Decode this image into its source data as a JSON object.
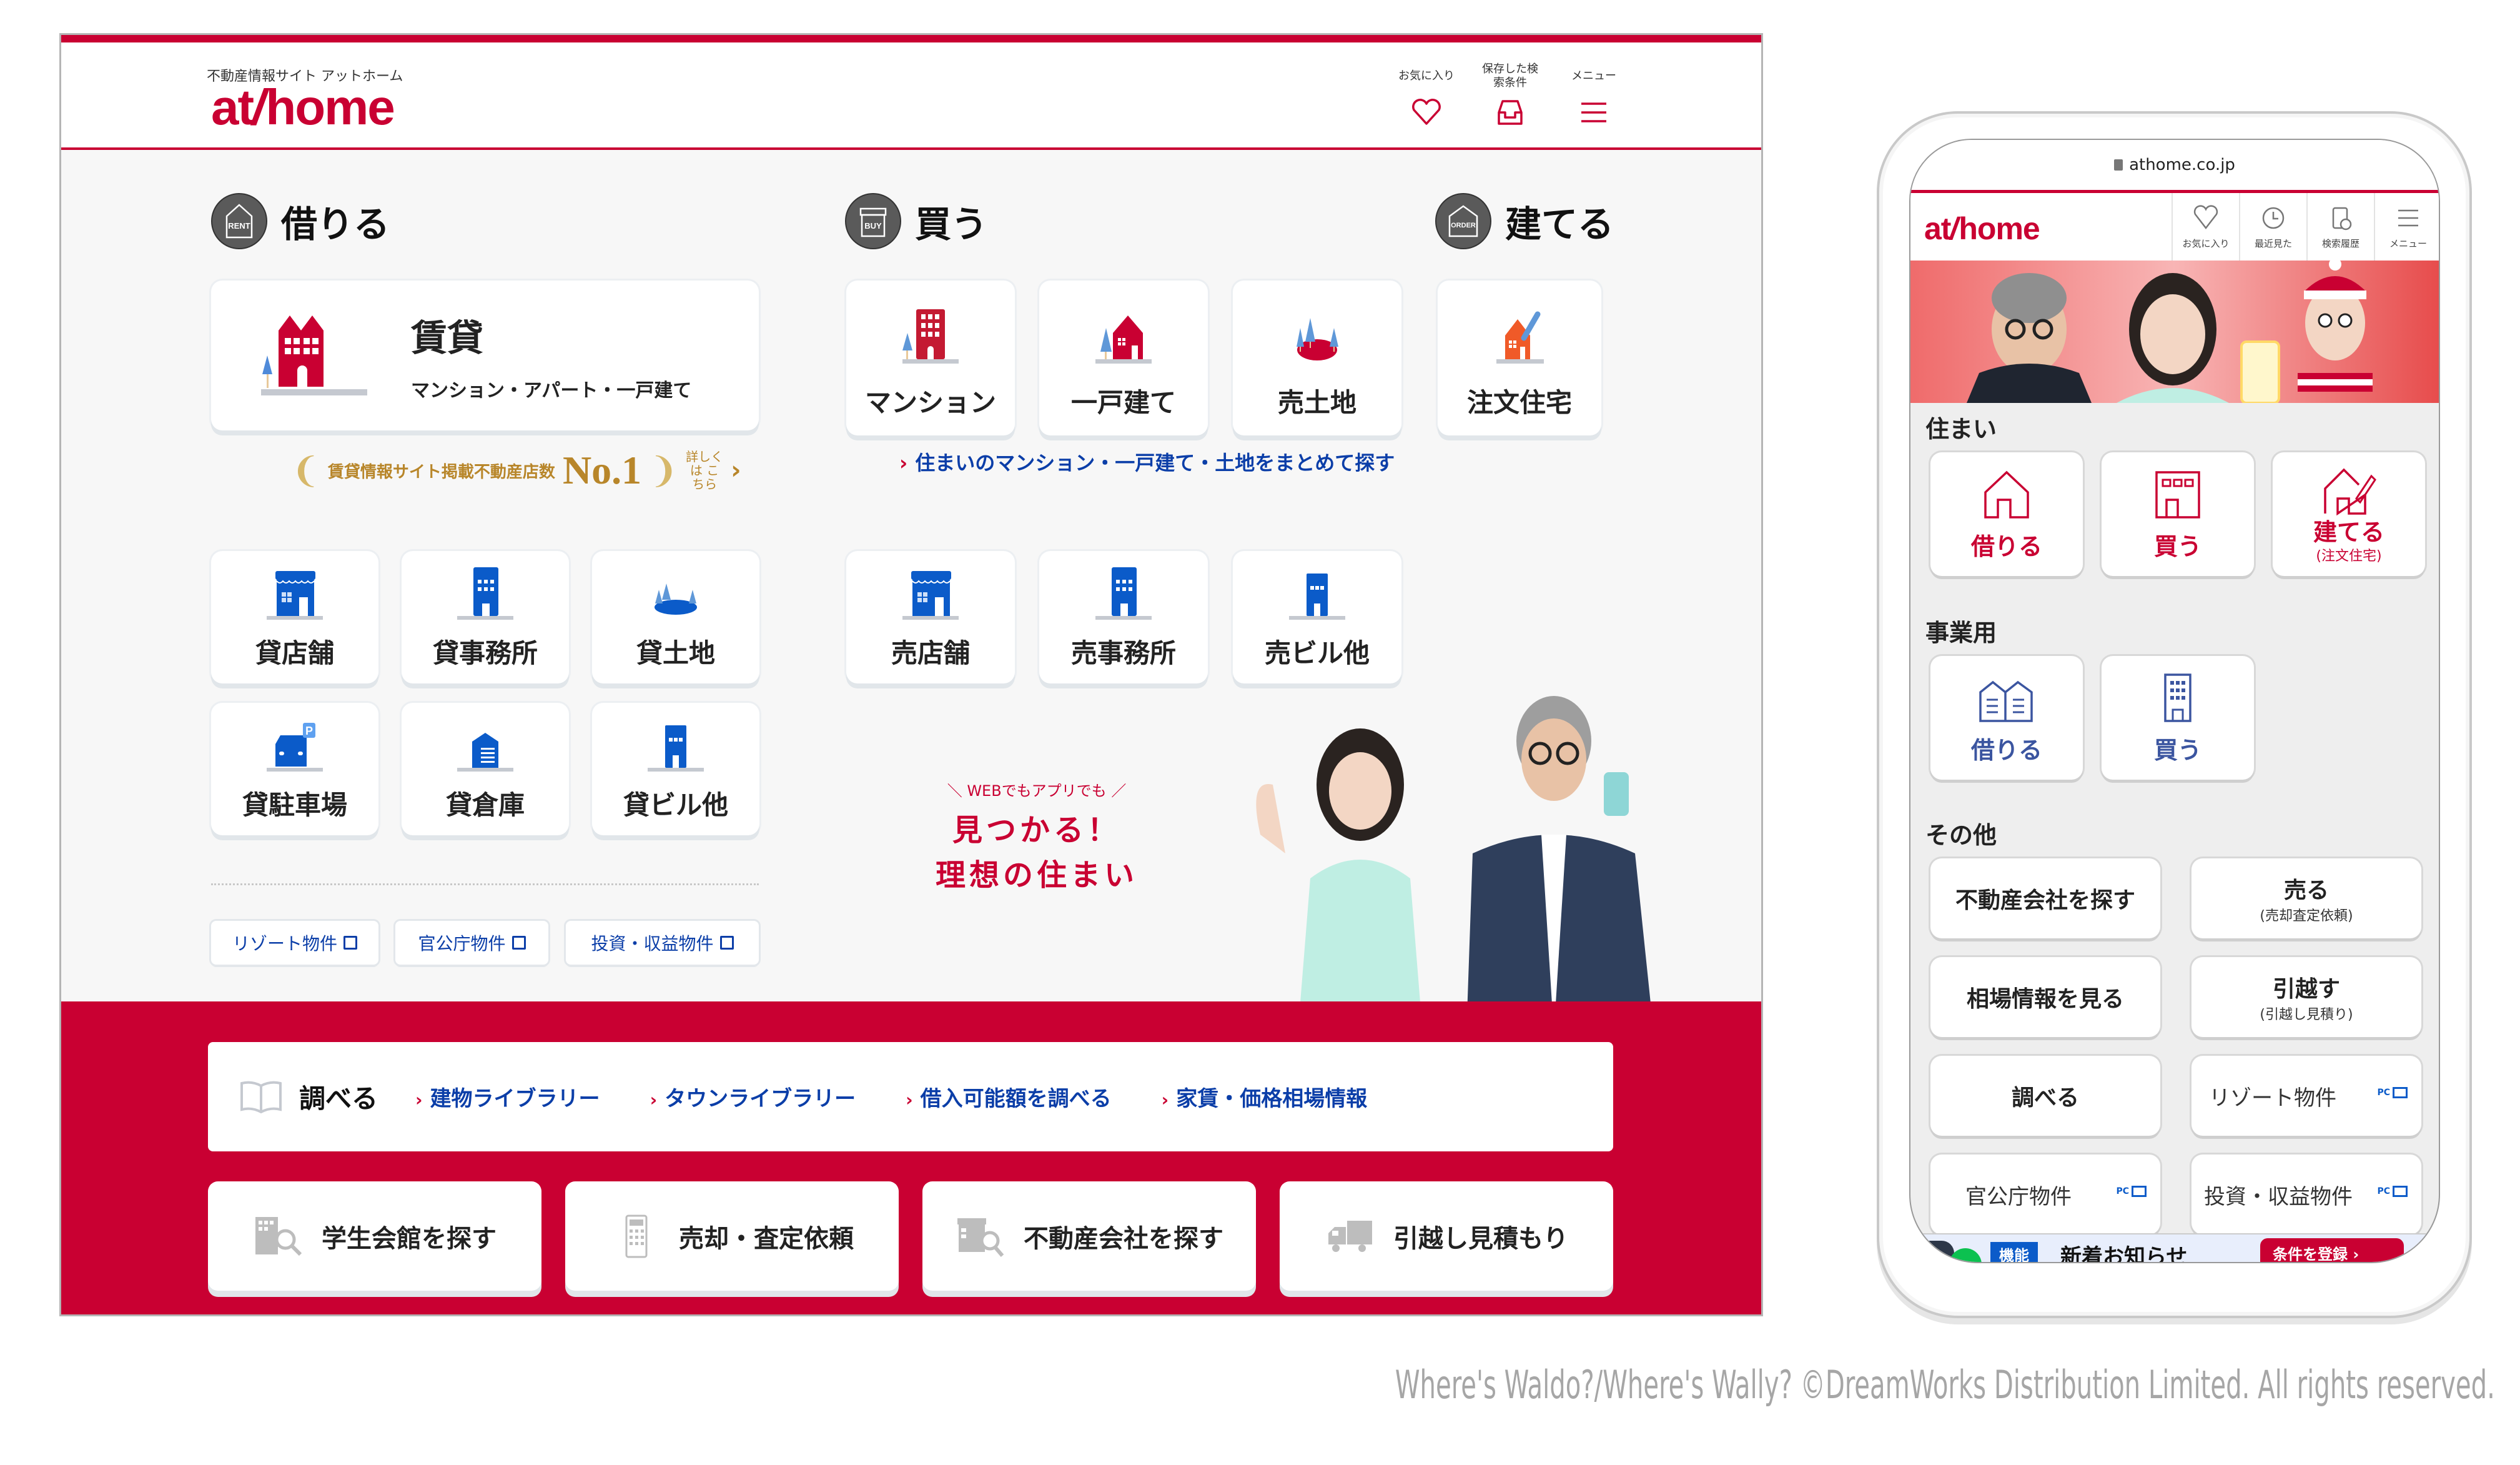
{
  "desktop": {
    "header": {
      "tagline": "不動産情報サイト アットホーム",
      "logo": "at home",
      "nav": [
        {
          "label": "お気に入り",
          "icon": "heart-icon"
        },
        {
          "label": "保存した検索条件",
          "icon": "tray-icon"
        },
        {
          "label": "メニュー",
          "icon": "hamburger-icon"
        }
      ]
    },
    "rent": {
      "badge": "RENT",
      "title": "借りる",
      "main_card": {
        "title": "賃貸",
        "subtitle": "マンション・アパート・一戸建て"
      },
      "no1": {
        "text": "賃貸情報サイト掲載不動産店数",
        "rank": "No.1",
        "more": "詳しくは こちら"
      },
      "business": [
        {
          "label": "貸店舗",
          "icon": "shop-icon"
        },
        {
          "label": "貸事務所",
          "icon": "office-building-icon"
        },
        {
          "label": "貸土地",
          "icon": "land-icon"
        },
        {
          "label": "貸駐車場",
          "icon": "parking-icon"
        },
        {
          "label": "貸倉庫",
          "icon": "warehouse-icon"
        },
        {
          "label": "貸ビル他",
          "icon": "building-icon"
        }
      ],
      "external_links": [
        "リゾート物件",
        "官公庁物件",
        "投資・収益物件"
      ]
    },
    "buy": {
      "badge": "BUY",
      "title": "買う",
      "residential": [
        {
          "label": "マンション",
          "icon": "condo-icon"
        },
        {
          "label": "一戸建て",
          "icon": "house-icon"
        },
        {
          "label": "売土地",
          "icon": "land-icon"
        }
      ],
      "link": "住まいのマンション・一戸建て・土地をまとめて探す",
      "business": [
        {
          "label": "売店舗",
          "icon": "shop-icon"
        },
        {
          "label": "売事務所",
          "icon": "office-building-icon"
        },
        {
          "label": "売ビル他",
          "icon": "building-icon"
        }
      ]
    },
    "build": {
      "badge": "ORDER",
      "title": "建てる",
      "card": {
        "label": "注文住宅",
        "icon": "custom-house-icon"
      }
    },
    "promo": {
      "small": "WEBでもアプリでも",
      "line1": "見つかる！",
      "line2": "理想の住まい"
    },
    "research": {
      "title": "調べる",
      "links": [
        "建物ライブラリー",
        "タウンライブラリー",
        "借入可能額を調べる",
        "家賃・価格相場情報"
      ]
    },
    "bottom_cards": [
      {
        "label": "学生会館を探す",
        "icon": "building-search-icon"
      },
      {
        "label": "売却・査定依頼",
        "icon": "calculator-icon"
      },
      {
        "label": "不動産会社を探す",
        "icon": "store-search-icon"
      },
      {
        "label": "引越し見積もり",
        "icon": "truck-icon"
      }
    ]
  },
  "phone": {
    "url": "athome.co.jp",
    "logo": "at home",
    "nav": [
      {
        "label": "お気に入り",
        "icon": "heart-icon"
      },
      {
        "label": "最近見た",
        "icon": "history-icon"
      },
      {
        "label": "検索履歴",
        "icon": "clipboard-clock-icon"
      },
      {
        "label": "メニュー",
        "icon": "hamburger-icon"
      }
    ],
    "sections": {
      "housing": {
        "title": "住まい",
        "items": [
          {
            "label": "借りる",
            "sub": ""
          },
          {
            "label": "買う",
            "sub": ""
          },
          {
            "label": "建てる",
            "sub": "(注文住宅)"
          }
        ]
      },
      "business": {
        "title": "事業用",
        "items": [
          {
            "label": "借りる"
          },
          {
            "label": "買う"
          }
        ]
      },
      "other": {
        "title": "その他",
        "items": [
          {
            "label": "不動産会社を探す",
            "sub": ""
          },
          {
            "label": "売る",
            "sub": "(売却査定依頼)"
          },
          {
            "label": "相場情報を見る",
            "sub": ""
          },
          {
            "label": "引越す",
            "sub": "(引越し見積り)"
          },
          {
            "label": "調べる",
            "sub": ""
          },
          {
            "label": "リゾート物件",
            "tag": "PC"
          },
          {
            "label": "官公庁物件",
            "tag": "PC"
          },
          {
            "label": "投資・収益物件",
            "tag": "PC"
          }
        ]
      }
    },
    "bottom_bar": {
      "badge": "機能",
      "text": "新着お知らせ",
      "button": "条件を登録 ›"
    }
  },
  "copyright": "Where's Waldo?/Where's Wally? ©DreamWorks Distribution Limited. All rights reserved.",
  "colors": {
    "brand": "#c90032",
    "link": "#0b3ea8",
    "icon_blue": "#0b5bc9",
    "gold": "#b8862a"
  }
}
